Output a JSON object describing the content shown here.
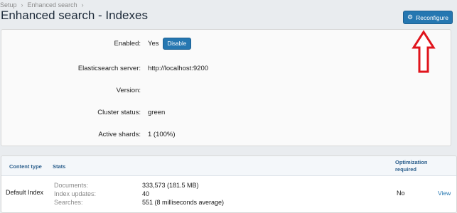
{
  "breadcrumb": [
    "Setup",
    "Enhanced search"
  ],
  "title": "Enhanced search - Indexes",
  "toolbar": {
    "reconfigure_label": "Reconfigure",
    "reconfigure_icon": "gear-icon"
  },
  "settings": {
    "enabled_label": "Enabled:",
    "enabled_value": "Yes",
    "disable_label": "Disable",
    "server_label": "Elasticsearch server:",
    "server_value": "http://localhost:9200",
    "version_label": "Version:",
    "version_value": "",
    "cluster_label": "Cluster status:",
    "cluster_value": "green",
    "shards_label": "Active shards:",
    "shards_value": "1 (100%)"
  },
  "table": {
    "headers": {
      "type": "Content type",
      "stats": "Stats",
      "optimization": "Optimization required"
    },
    "rows": [
      {
        "type": "Default Index",
        "stats": {
          "documents_label": "Documents:",
          "documents_value": "333,573 (181.5 MB)",
          "updates_label": "Index updates:",
          "updates_value": "40",
          "searches_label": "Searches:",
          "searches_value": "551 (8 milliseconds average)"
        },
        "optimization": "No",
        "action": "View"
      }
    ]
  },
  "colors": {
    "accent": "#2577b1",
    "annotation_arrow": "#e0141c"
  }
}
